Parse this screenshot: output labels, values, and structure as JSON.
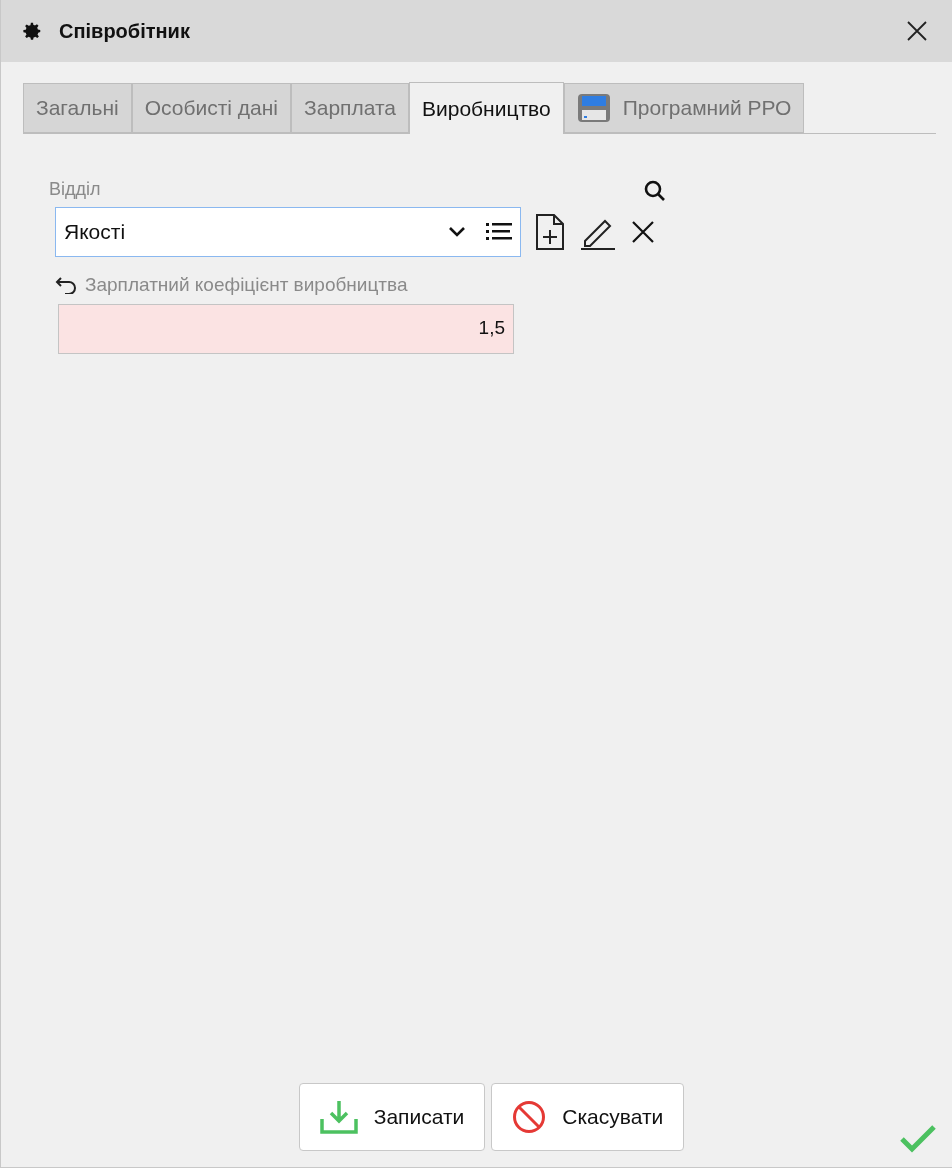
{
  "window": {
    "title": "Співробітник"
  },
  "tabs": [
    {
      "label": "Загальні",
      "selected": false,
      "kind": "text"
    },
    {
      "label": "Особисті дані",
      "selected": false,
      "kind": "text"
    },
    {
      "label": "Зарплата",
      "selected": false,
      "kind": "text"
    },
    {
      "label": "Виробництво",
      "selected": true,
      "kind": "text"
    },
    {
      "label": "Програмний РРО",
      "selected": false,
      "kind": "icon"
    }
  ],
  "department": {
    "label": "Відділ",
    "value": "Якості",
    "focused": true
  },
  "coefficient": {
    "label": "Зарплатний коефіцієнт виробництва",
    "value": "1,5",
    "highlighted": true
  },
  "buttons": [
    {
      "label": "Записати",
      "kind": "save"
    },
    {
      "label": "Скасувати",
      "kind": "cancel"
    }
  ]
}
